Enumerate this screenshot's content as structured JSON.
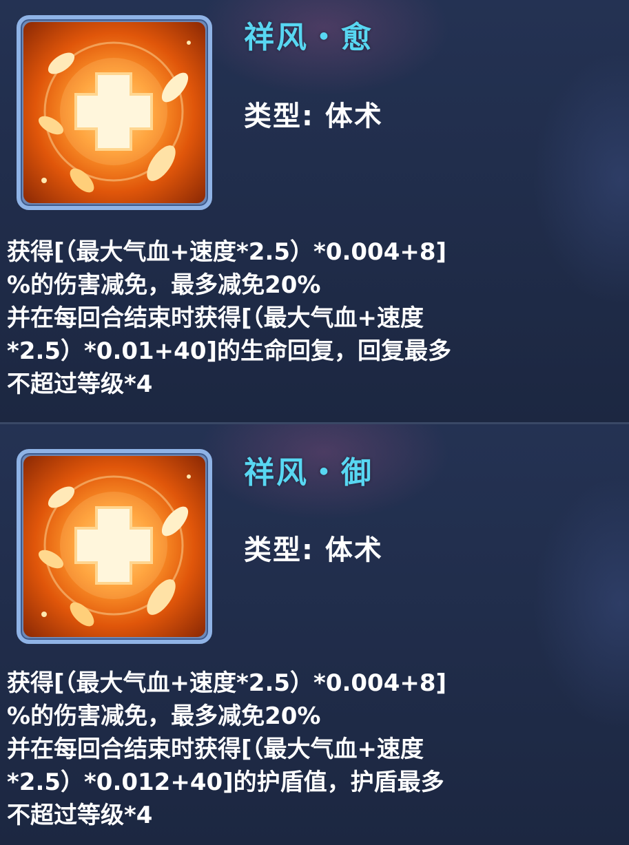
{
  "skills": [
    {
      "name": "祥风・愈",
      "type": "类型: 体术",
      "desc_lines": [
        "获得[（最大气血+速度*2.5）*0.004+8]",
        "%的伤害减免，最多减免20%",
        "并在每回合结束时获得[（最大气血+速度",
        "*2.5）*0.01+40]的生命回复，回复最多",
        "不超过等级*4"
      ]
    },
    {
      "name": "祥风・御",
      "type": "类型: 体术",
      "desc_lines": [
        "获得[（最大气血+速度*2.5）*0.004+8]",
        "%的伤害减免，最多减免20%",
        "并在每回合结束时获得[（最大气血+速度",
        "*2.5）*0.012+40]的护盾值，护盾最多",
        "不超过等级*4"
      ]
    }
  ],
  "icon": "heal-cross-leaves-icon",
  "colors": {
    "title": "#58d7f2",
    "text": "#ffffff",
    "frame": "#8fb3e6",
    "icon_orange": "#ff9a2e"
  }
}
